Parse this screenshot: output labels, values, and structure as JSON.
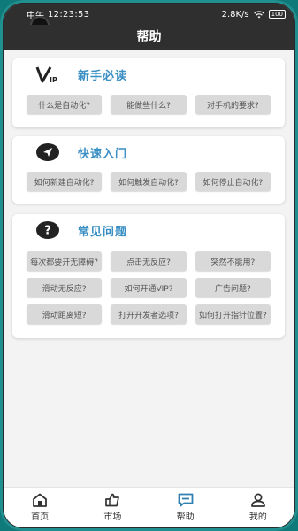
{
  "status": {
    "ampm": "中午",
    "time": "12:23:53",
    "speed": "2.8K/s",
    "battery": "100"
  },
  "nav": {
    "title": "帮助"
  },
  "sections": [
    {
      "title": "新手必读",
      "icon": "vip-icon",
      "buttons": [
        "什么是自动化?",
        "能做些什么?",
        "对手机的要求?"
      ]
    },
    {
      "title": "快速入门",
      "icon": "navigation-arrow-icon",
      "buttons": [
        "如何新建自动化?",
        "如何触发自动化?",
        "如何停止自动化?"
      ]
    },
    {
      "title": "常见问题",
      "icon": "question-icon",
      "buttons": [
        "每次都要开无障碍?",
        "点击无反应?",
        "突然不能用?",
        "滑动无反应?",
        "如何开通VIP?",
        "广告问题?",
        "滑动距离短?",
        "打开开发者选项?",
        "如何打开指针位置?"
      ]
    }
  ],
  "tabs": [
    {
      "label": "首页",
      "icon": "home-icon"
    },
    {
      "label": "市场",
      "icon": "market-icon"
    },
    {
      "label": "帮助",
      "icon": "help-icon"
    },
    {
      "label": "我的",
      "icon": "profile-icon"
    }
  ]
}
